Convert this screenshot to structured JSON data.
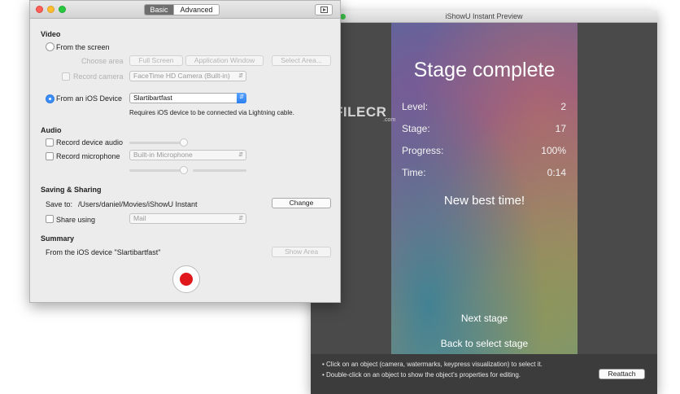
{
  "preview": {
    "title": "iShowU Instant Preview",
    "game": {
      "title": "Stage complete",
      "stats": [
        {
          "label": "Level:",
          "value": "2"
        },
        {
          "label": "Stage:",
          "value": "17"
        },
        {
          "label": "Progress:",
          "value": "100%"
        },
        {
          "label": "Time:",
          "value": "0:14"
        }
      ],
      "best_time": "New best time!",
      "next_stage": "Next stage",
      "back": "Back to select stage"
    },
    "hints": [
      "• Click on an object (camera, watermarks, keypress visualization) to select it.",
      "• Double-click on an object to show the object's properties for editing."
    ],
    "reattach_label": "Reattach"
  },
  "watermark": {
    "text": "FILECR",
    "sub": ".com"
  },
  "main": {
    "tabs": {
      "basic": "Basic",
      "advanced": "Advanced"
    },
    "video": {
      "heading": "Video",
      "from_screen": "From the screen",
      "choose_area": "Choose area",
      "full_screen": "Full Screen",
      "app_window": "Application Window",
      "select_area": "Select Area...",
      "record_camera": "Record camera",
      "camera_value": "FaceTime HD Camera (Built-in)",
      "from_ios": "From an iOS Device",
      "ios_value": "Slartibartfast",
      "ios_note": "Requires iOS device to be connected via Lightning cable."
    },
    "audio": {
      "heading": "Audio",
      "record_device": "Record device audio",
      "record_mic": "Record microphone",
      "mic_value": "Built-in Microphone"
    },
    "saving": {
      "heading": "Saving & Sharing",
      "save_to": "Save to:",
      "path": "/Users/daniel/Movies/iShowU Instant",
      "change": "Change",
      "share_using": "Share using",
      "share_value": "Mail"
    },
    "summary": {
      "heading": "Summary",
      "text": "From the iOS device \"Slartibartfast\"",
      "show_area": "Show Area"
    }
  },
  "colors": {
    "record": "#e1181b",
    "accent": "#3b8df7"
  }
}
